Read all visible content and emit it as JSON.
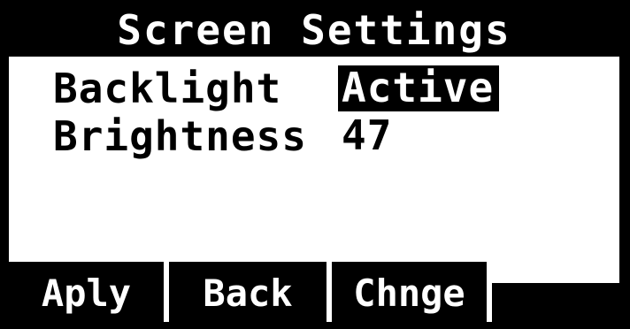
{
  "header": {
    "title": "Screen Settings"
  },
  "settings": {
    "items": [
      {
        "label": "Backlight",
        "value": "Active",
        "selected": true
      },
      {
        "label": "Brightness",
        "value": "47",
        "selected": false
      }
    ]
  },
  "softkeys": {
    "items": [
      {
        "label": "Aply"
      },
      {
        "label": "Back"
      },
      {
        "label": "Chnge"
      },
      {
        "label": ""
      }
    ]
  },
  "colors": {
    "background": "#ffffff",
    "foreground": "#000000",
    "highlight": "#000000",
    "highlight_text": "#ffffff"
  }
}
